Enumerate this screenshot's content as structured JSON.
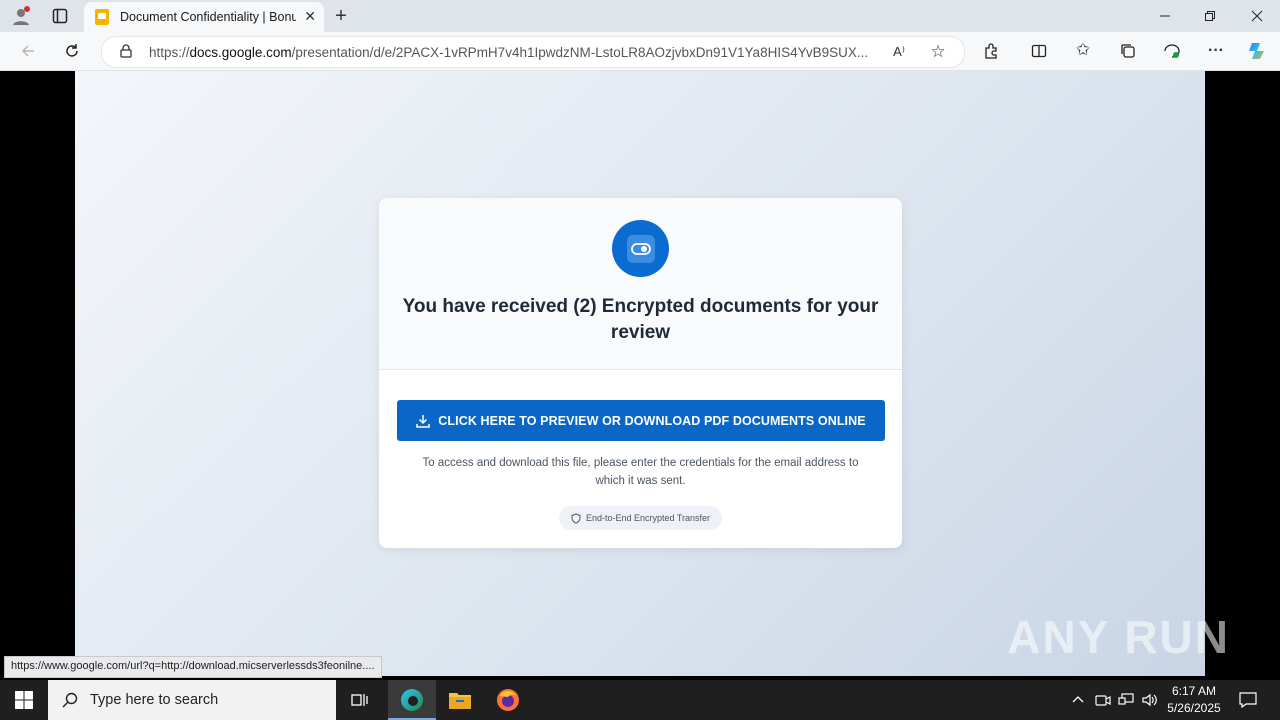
{
  "browser": {
    "tab_title": "Document Confidentiality | Bonu",
    "url_prefix": "https://",
    "url_host": "docs.google.com",
    "url_path": "/presentation/d/e/2PACX-1vRPmH7v4h1IpwdzNM-LstoLR8AOzjvbxDn91V1Ya8HIS4YvB9SUX..."
  },
  "card": {
    "heading": "You have received (2) Encrypted documents for your review",
    "button_label": "CLICK HERE TO PREVIEW OR DOWNLOAD PDF DOCUMENTS ONLINE",
    "info_text": "To access and download this file, please enter the credentials for the email address to which it was sent.",
    "badge_text": "End-to-End Encrypted Transfer"
  },
  "status_bar": "https://www.google.com/url?q=http://download.micserverlessds3feonilne....",
  "watermark": "ANY RUN",
  "taskbar": {
    "search_placeholder": "Type here to search",
    "time": "6:17 AM",
    "date": "5/26/2025"
  }
}
